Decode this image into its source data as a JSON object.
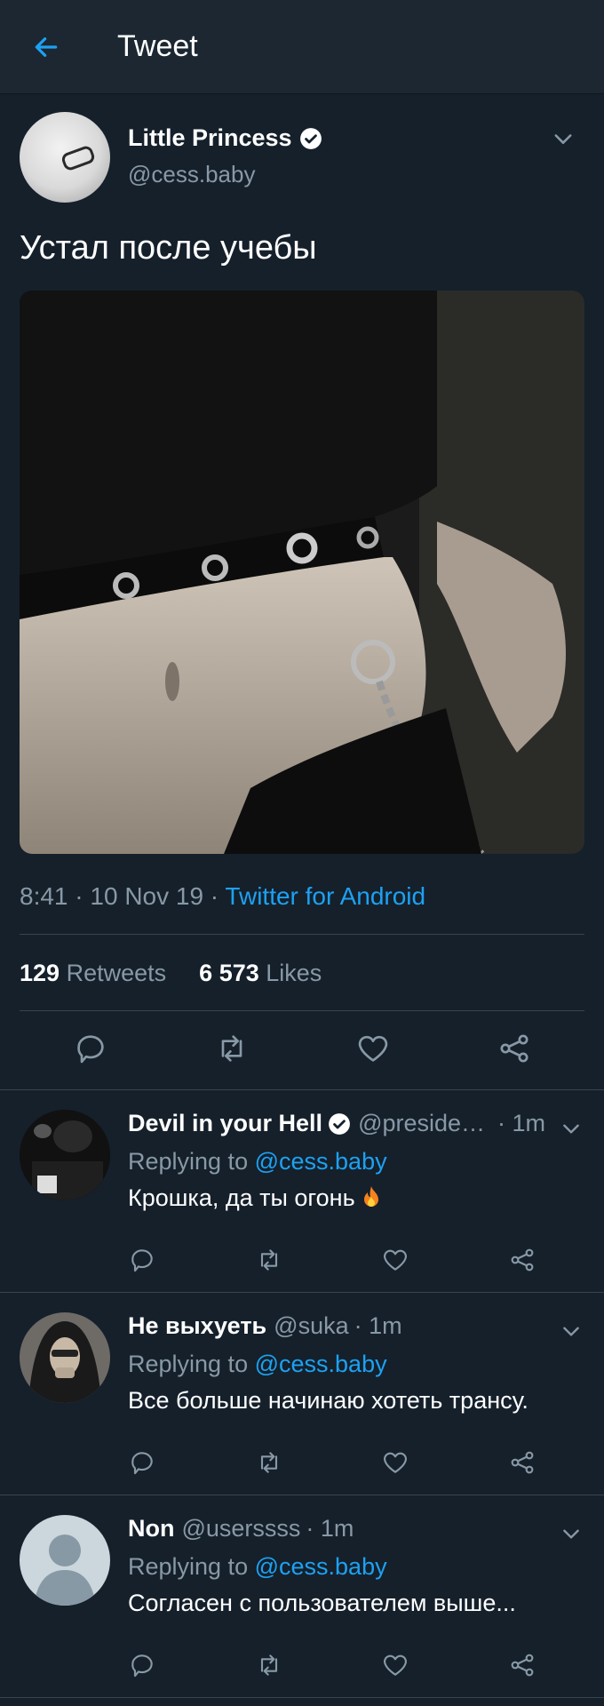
{
  "header": {
    "title": "Tweet",
    "back_icon": "arrow-left-icon"
  },
  "tweet": {
    "author_name": "Little Princess",
    "author_handle": "@cess.baby",
    "text": "Устал после учебы",
    "time": "8:41",
    "date": "10 Nov 19",
    "sep": " · ",
    "client": "Twitter for Android",
    "retweets": "129",
    "retweets_label": "Retweets",
    "likes": "6 573",
    "likes_label": "Likes"
  },
  "replies": [
    {
      "name": "Devil in your Hell",
      "verified": true,
      "handle": "@presiden…",
      "time": "· 1m",
      "replying_prefix": "Replying to",
      "replying_to": "@cess.baby",
      "text": "Крошка, да ты огонь"
    },
    {
      "name": "Не выхуеть",
      "verified": false,
      "handle": "@suka",
      "time": "· 1m",
      "replying_prefix": "Replying to",
      "replying_to": "@cess.baby",
      "text": "Все больше начинаю хотеть трансу."
    },
    {
      "name": "Non",
      "verified": false,
      "handle": "@userssss",
      "time": "· 1m",
      "replying_prefix": "Replying to",
      "replying_to": "@cess.baby",
      "text": "Согласен с пользователем выше..."
    }
  ],
  "colors": {
    "background": "#15202b",
    "header": "#1c2732",
    "accent": "#1da1f2",
    "secondary_text": "#8899a6",
    "divider": "#38444d"
  }
}
